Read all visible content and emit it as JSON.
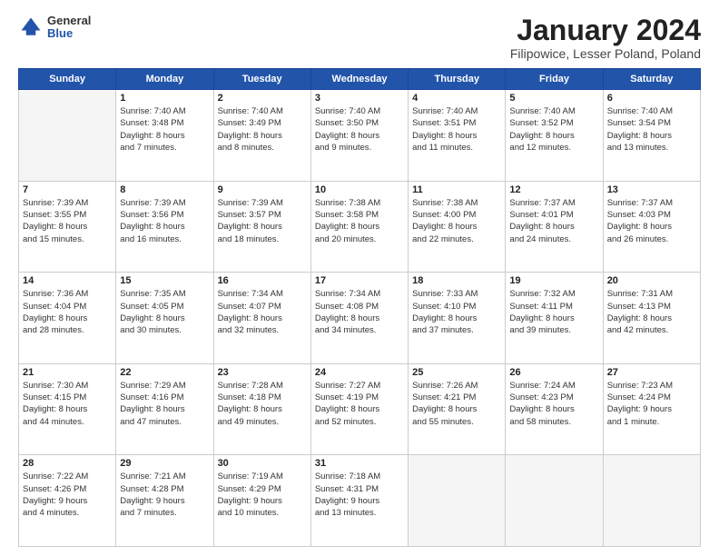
{
  "header": {
    "logo_general": "General",
    "logo_blue": "Blue",
    "title": "January 2024",
    "location": "Filipowice, Lesser Poland, Poland"
  },
  "days_of_week": [
    "Sunday",
    "Monday",
    "Tuesday",
    "Wednesday",
    "Thursday",
    "Friday",
    "Saturday"
  ],
  "weeks": [
    [
      {
        "day": "",
        "info": ""
      },
      {
        "day": "1",
        "info": "Sunrise: 7:40 AM\nSunset: 3:48 PM\nDaylight: 8 hours\nand 7 minutes."
      },
      {
        "day": "2",
        "info": "Sunrise: 7:40 AM\nSunset: 3:49 PM\nDaylight: 8 hours\nand 8 minutes."
      },
      {
        "day": "3",
        "info": "Sunrise: 7:40 AM\nSunset: 3:50 PM\nDaylight: 8 hours\nand 9 minutes."
      },
      {
        "day": "4",
        "info": "Sunrise: 7:40 AM\nSunset: 3:51 PM\nDaylight: 8 hours\nand 11 minutes."
      },
      {
        "day": "5",
        "info": "Sunrise: 7:40 AM\nSunset: 3:52 PM\nDaylight: 8 hours\nand 12 minutes."
      },
      {
        "day": "6",
        "info": "Sunrise: 7:40 AM\nSunset: 3:54 PM\nDaylight: 8 hours\nand 13 minutes."
      }
    ],
    [
      {
        "day": "7",
        "info": "Sunrise: 7:39 AM\nSunset: 3:55 PM\nDaylight: 8 hours\nand 15 minutes."
      },
      {
        "day": "8",
        "info": "Sunrise: 7:39 AM\nSunset: 3:56 PM\nDaylight: 8 hours\nand 16 minutes."
      },
      {
        "day": "9",
        "info": "Sunrise: 7:39 AM\nSunset: 3:57 PM\nDaylight: 8 hours\nand 18 minutes."
      },
      {
        "day": "10",
        "info": "Sunrise: 7:38 AM\nSunset: 3:58 PM\nDaylight: 8 hours\nand 20 minutes."
      },
      {
        "day": "11",
        "info": "Sunrise: 7:38 AM\nSunset: 4:00 PM\nDaylight: 8 hours\nand 22 minutes."
      },
      {
        "day": "12",
        "info": "Sunrise: 7:37 AM\nSunset: 4:01 PM\nDaylight: 8 hours\nand 24 minutes."
      },
      {
        "day": "13",
        "info": "Sunrise: 7:37 AM\nSunset: 4:03 PM\nDaylight: 8 hours\nand 26 minutes."
      }
    ],
    [
      {
        "day": "14",
        "info": "Sunrise: 7:36 AM\nSunset: 4:04 PM\nDaylight: 8 hours\nand 28 minutes."
      },
      {
        "day": "15",
        "info": "Sunrise: 7:35 AM\nSunset: 4:05 PM\nDaylight: 8 hours\nand 30 minutes."
      },
      {
        "day": "16",
        "info": "Sunrise: 7:34 AM\nSunset: 4:07 PM\nDaylight: 8 hours\nand 32 minutes."
      },
      {
        "day": "17",
        "info": "Sunrise: 7:34 AM\nSunset: 4:08 PM\nDaylight: 8 hours\nand 34 minutes."
      },
      {
        "day": "18",
        "info": "Sunrise: 7:33 AM\nSunset: 4:10 PM\nDaylight: 8 hours\nand 37 minutes."
      },
      {
        "day": "19",
        "info": "Sunrise: 7:32 AM\nSunset: 4:11 PM\nDaylight: 8 hours\nand 39 minutes."
      },
      {
        "day": "20",
        "info": "Sunrise: 7:31 AM\nSunset: 4:13 PM\nDaylight: 8 hours\nand 42 minutes."
      }
    ],
    [
      {
        "day": "21",
        "info": "Sunrise: 7:30 AM\nSunset: 4:15 PM\nDaylight: 8 hours\nand 44 minutes."
      },
      {
        "day": "22",
        "info": "Sunrise: 7:29 AM\nSunset: 4:16 PM\nDaylight: 8 hours\nand 47 minutes."
      },
      {
        "day": "23",
        "info": "Sunrise: 7:28 AM\nSunset: 4:18 PM\nDaylight: 8 hours\nand 49 minutes."
      },
      {
        "day": "24",
        "info": "Sunrise: 7:27 AM\nSunset: 4:19 PM\nDaylight: 8 hours\nand 52 minutes."
      },
      {
        "day": "25",
        "info": "Sunrise: 7:26 AM\nSunset: 4:21 PM\nDaylight: 8 hours\nand 55 minutes."
      },
      {
        "day": "26",
        "info": "Sunrise: 7:24 AM\nSunset: 4:23 PM\nDaylight: 8 hours\nand 58 minutes."
      },
      {
        "day": "27",
        "info": "Sunrise: 7:23 AM\nSunset: 4:24 PM\nDaylight: 9 hours\nand 1 minute."
      }
    ],
    [
      {
        "day": "28",
        "info": "Sunrise: 7:22 AM\nSunset: 4:26 PM\nDaylight: 9 hours\nand 4 minutes."
      },
      {
        "day": "29",
        "info": "Sunrise: 7:21 AM\nSunset: 4:28 PM\nDaylight: 9 hours\nand 7 minutes."
      },
      {
        "day": "30",
        "info": "Sunrise: 7:19 AM\nSunset: 4:29 PM\nDaylight: 9 hours\nand 10 minutes."
      },
      {
        "day": "31",
        "info": "Sunrise: 7:18 AM\nSunset: 4:31 PM\nDaylight: 9 hours\nand 13 minutes."
      },
      {
        "day": "",
        "info": ""
      },
      {
        "day": "",
        "info": ""
      },
      {
        "day": "",
        "info": ""
      }
    ]
  ]
}
